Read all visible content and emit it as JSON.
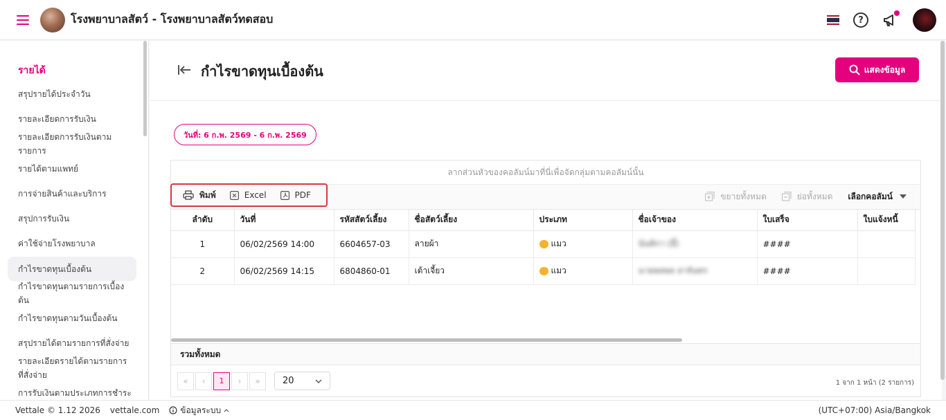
{
  "app": {
    "title": "โรงพยาบาลสัตว์ - โรงพยาบาลสัตว์ทดสอบ",
    "accent_color": "#e5007d"
  },
  "sidebar": {
    "heading": "รายได้",
    "items": [
      {
        "label": "สรุปรายได้ประจำวัน",
        "active": false
      },
      {
        "label": "รายละเอียดการรับเงิน",
        "active": false
      },
      {
        "label": "รายละเอียดการรับเงินตามรายการ",
        "active": false
      },
      {
        "label": "รายได้ตามแพทย์",
        "active": false
      },
      {
        "label": "การจ่ายสินค้าและบริการ",
        "active": false
      },
      {
        "label": "สรุปการรับเงิน",
        "active": false
      },
      {
        "label": "ค่าใช้จ่ายโรงพยาบาล",
        "active": false
      },
      {
        "label": "กำไรขาดทุนเบื้องต้น",
        "active": true
      },
      {
        "label": "กำไรขาดทุนตามรายการเบื้องต้น",
        "active": false
      },
      {
        "label": "กำไรขาดทุนตามวันเบื้องต้น",
        "active": false
      },
      {
        "label": "สรุปรายได้ตามรายการที่สั่งจ่าย",
        "active": false
      },
      {
        "label": "รายละเอียดรายได้ตามรายการที่สั่งจ่าย",
        "active": false
      },
      {
        "label": "การรับเงินตามประเภทการชำระ",
        "active": false
      }
    ]
  },
  "page": {
    "title": "กำไรขาดทุนเบื้องต้น",
    "show_button": "แสดงข้อมูล",
    "date_range": "วันที่: 6 ก.พ. 2569 - 6 ก.พ. 2569"
  },
  "grid": {
    "group_hint": "ลากส่วนหัวของคอลัมน์มาที่นี่เพื่อจัดกลุ่มตามคอลัมน์นั้น",
    "toolbar": {
      "print": "พิมพ์",
      "excel": "Excel",
      "pdf": "PDF",
      "expand_all": "ขยายทั้งหมด",
      "collapse_all": "ย่อทั้งหมด",
      "choose_columns": "เลือกคอลัมน์"
    },
    "columns": [
      "ลำดับ",
      "วันที่",
      "รหัสสัตว์เลี้ยง",
      "ชื่อสัตว์เลี้ยง",
      "ประเภท",
      "ชื่อเจ้าของ",
      "ใบเสร็จ",
      "ใบแจ้งหนี้"
    ],
    "rows": [
      {
        "no": "1",
        "date": "06/02/2569 14:00",
        "pet_code": "6604657-03",
        "pet_name": "ลายผ้า",
        "type": "แมว",
        "owner": "นันทิกา (อี๋)",
        "receipt": "####",
        "invoice": ""
      },
      {
        "no": "2",
        "date": "06/02/2569 14:15",
        "pet_code": "6804860-01",
        "pet_name": "เต้าเจี้ยว",
        "type": "แมว",
        "owner": "นายพลพล ลาจันทร",
        "receipt": "####",
        "invoice": ""
      }
    ],
    "summary_label": "รวมทั้งหมด",
    "pager": {
      "current_page": "1",
      "page_size": "20",
      "info": "1 จาก 1 หน้า (2 รายการ)"
    }
  },
  "footer": {
    "version": "Vettale © 1.12 2026",
    "site": "vettale.com",
    "system_info": "ข้อมูลระบบ",
    "timezone": "(UTC+07:00) Asia/Bangkok"
  }
}
